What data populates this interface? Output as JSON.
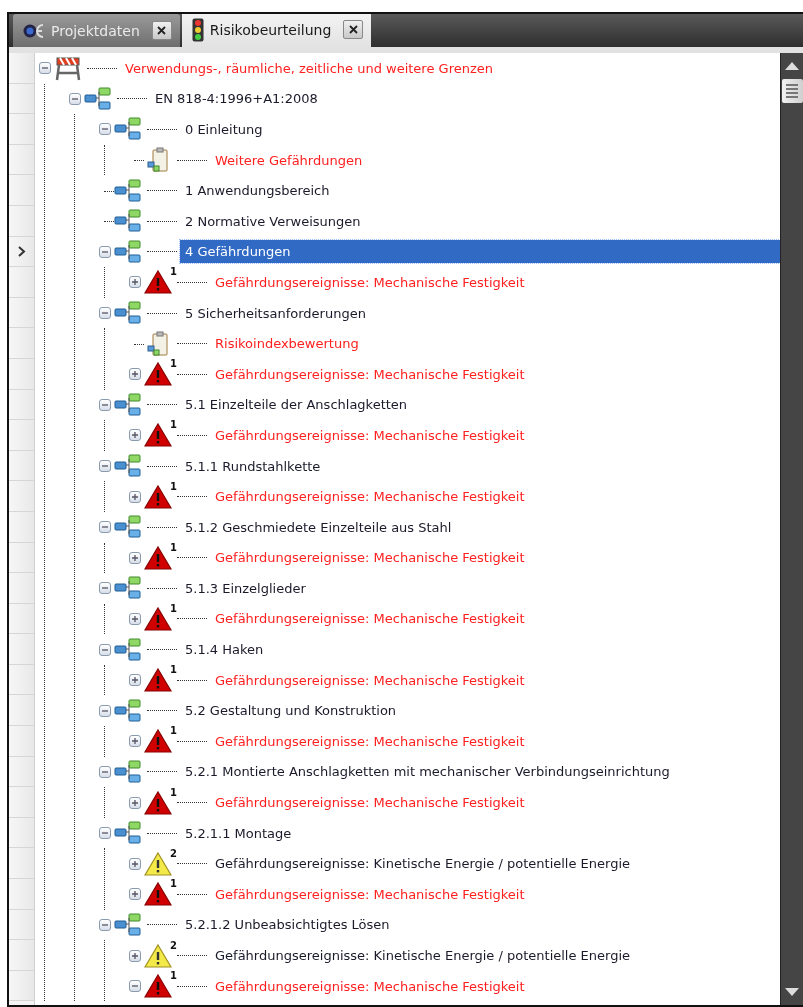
{
  "tabs": [
    {
      "label": "Projektdaten",
      "kind": "ce",
      "selected": false
    },
    {
      "label": "Risikobeurteilung",
      "kind": "traffic-light",
      "selected": true
    }
  ],
  "tree": [
    {
      "label": "Verwendungs-, räumliche, zeitliche und weitere Grenzen",
      "kind": "limits",
      "expanded": true,
      "selected": false,
      "children": [
        {
          "label": "EN 818-4:1996+A1:2008",
          "kind": "section",
          "expanded": true,
          "selected": false,
          "children": [
            {
              "label": "0 Einleitung",
              "kind": "section",
              "expanded": true,
              "selected": false,
              "children": [
                {
                  "label": "Weitere Gefährdungen",
                  "kind": "document",
                  "selected": false
                }
              ]
            },
            {
              "label": "1 Anwendungsbereich",
              "kind": "section",
              "selected": false
            },
            {
              "label": "2 Normative Verweisungen",
              "kind": "section",
              "selected": false
            },
            {
              "label": "4 Gefährdungen",
              "kind": "section",
              "expanded": true,
              "selected": true,
              "children": [
                {
                  "label": "Gefährdungsereignisse: Mechanische Festigkeit",
                  "kind": "hazard",
                  "badge": "1",
                  "expanded": false,
                  "selected": false
                }
              ]
            },
            {
              "label": "5 Sicherheitsanforderungen",
              "kind": "section",
              "expanded": true,
              "selected": false,
              "children": [
                {
                  "label": "Risikoindexbewertung",
                  "kind": "document",
                  "selected": false
                },
                {
                  "label": "Gefährdungsereignisse: Mechanische Festigkeit",
                  "kind": "hazard",
                  "badge": "1",
                  "expanded": false,
                  "selected": false
                }
              ]
            },
            {
              "label": "5.1 Einzelteile der Anschlagketten",
              "kind": "section",
              "expanded": true,
              "selected": false,
              "children": [
                {
                  "label": "Gefährdungsereignisse: Mechanische Festigkeit",
                  "kind": "hazard",
                  "badge": "1",
                  "expanded": false,
                  "selected": false
                }
              ]
            },
            {
              "label": "5.1.1 Rundstahlkette",
              "kind": "section",
              "expanded": true,
              "selected": false,
              "children": [
                {
                  "label": "Gefährdungsereignisse: Mechanische Festigkeit",
                  "kind": "hazard",
                  "badge": "1",
                  "expanded": false,
                  "selected": false
                }
              ]
            },
            {
              "label": "5.1.2 Geschmiedete Einzelteile aus Stahl",
              "kind": "section",
              "expanded": true,
              "selected": false,
              "children": [
                {
                  "label": "Gefährdungsereignisse: Mechanische Festigkeit",
                  "kind": "hazard",
                  "badge": "1",
                  "expanded": false,
                  "selected": false
                }
              ]
            },
            {
              "label": "5.1.3 Einzelglieder",
              "kind": "section",
              "expanded": true,
              "selected": false,
              "children": [
                {
                  "label": "Gefährdungsereignisse: Mechanische Festigkeit",
                  "kind": "hazard",
                  "badge": "1",
                  "expanded": false,
                  "selected": false
                }
              ]
            },
            {
              "label": "5.1.4 Haken",
              "kind": "section",
              "expanded": true,
              "selected": false,
              "children": [
                {
                  "label": "Gefährdungsereignisse: Mechanische Festigkeit",
                  "kind": "hazard",
                  "badge": "1",
                  "expanded": false,
                  "selected": false
                }
              ]
            },
            {
              "label": "5.2 Gestaltung und Konstruktion",
              "kind": "section",
              "expanded": true,
              "selected": false,
              "children": [
                {
                  "label": "Gefährdungsereignisse: Mechanische Festigkeit",
                  "kind": "hazard",
                  "badge": "1",
                  "expanded": false,
                  "selected": false
                }
              ]
            },
            {
              "label": "5.2.1 Montierte Anschlagketten mit mechanischer Verbindungseinrichtung",
              "kind": "section",
              "expanded": true,
              "selected": false,
              "children": [
                {
                  "label": "Gefährdungsereignisse: Mechanische Festigkeit",
                  "kind": "hazard",
                  "badge": "1",
                  "expanded": false,
                  "selected": false
                }
              ]
            },
            {
              "label": "5.2.1.1 Montage",
              "kind": "section",
              "expanded": true,
              "selected": false,
              "children": [
                {
                  "label": "Gefährdungsereignisse: Kinetische Energie / potentielle Energie",
                  "kind": "warning",
                  "badge": "2",
                  "expanded": false,
                  "selected": false
                },
                {
                  "label": "Gefährdungsereignisse: Mechanische Festigkeit",
                  "kind": "hazard",
                  "badge": "1",
                  "expanded": false,
                  "selected": false
                }
              ]
            },
            {
              "label": "5.2.1.2 Unbeabsichtigtes Lösen",
              "kind": "section",
              "expanded": true,
              "selected": false,
              "children": [
                {
                  "label": "Gefährdungsereignisse: Kinetische Energie / potentielle Energie",
                  "kind": "warning",
                  "badge": "2",
                  "expanded": false,
                  "selected": false
                },
                {
                  "label": "Gefährdungsereignisse: Mechanische Festigkeit",
                  "kind": "hazard",
                  "badge": "1",
                  "expanded": true,
                  "selected": false
                }
              ]
            }
          ]
        }
      ]
    }
  ]
}
